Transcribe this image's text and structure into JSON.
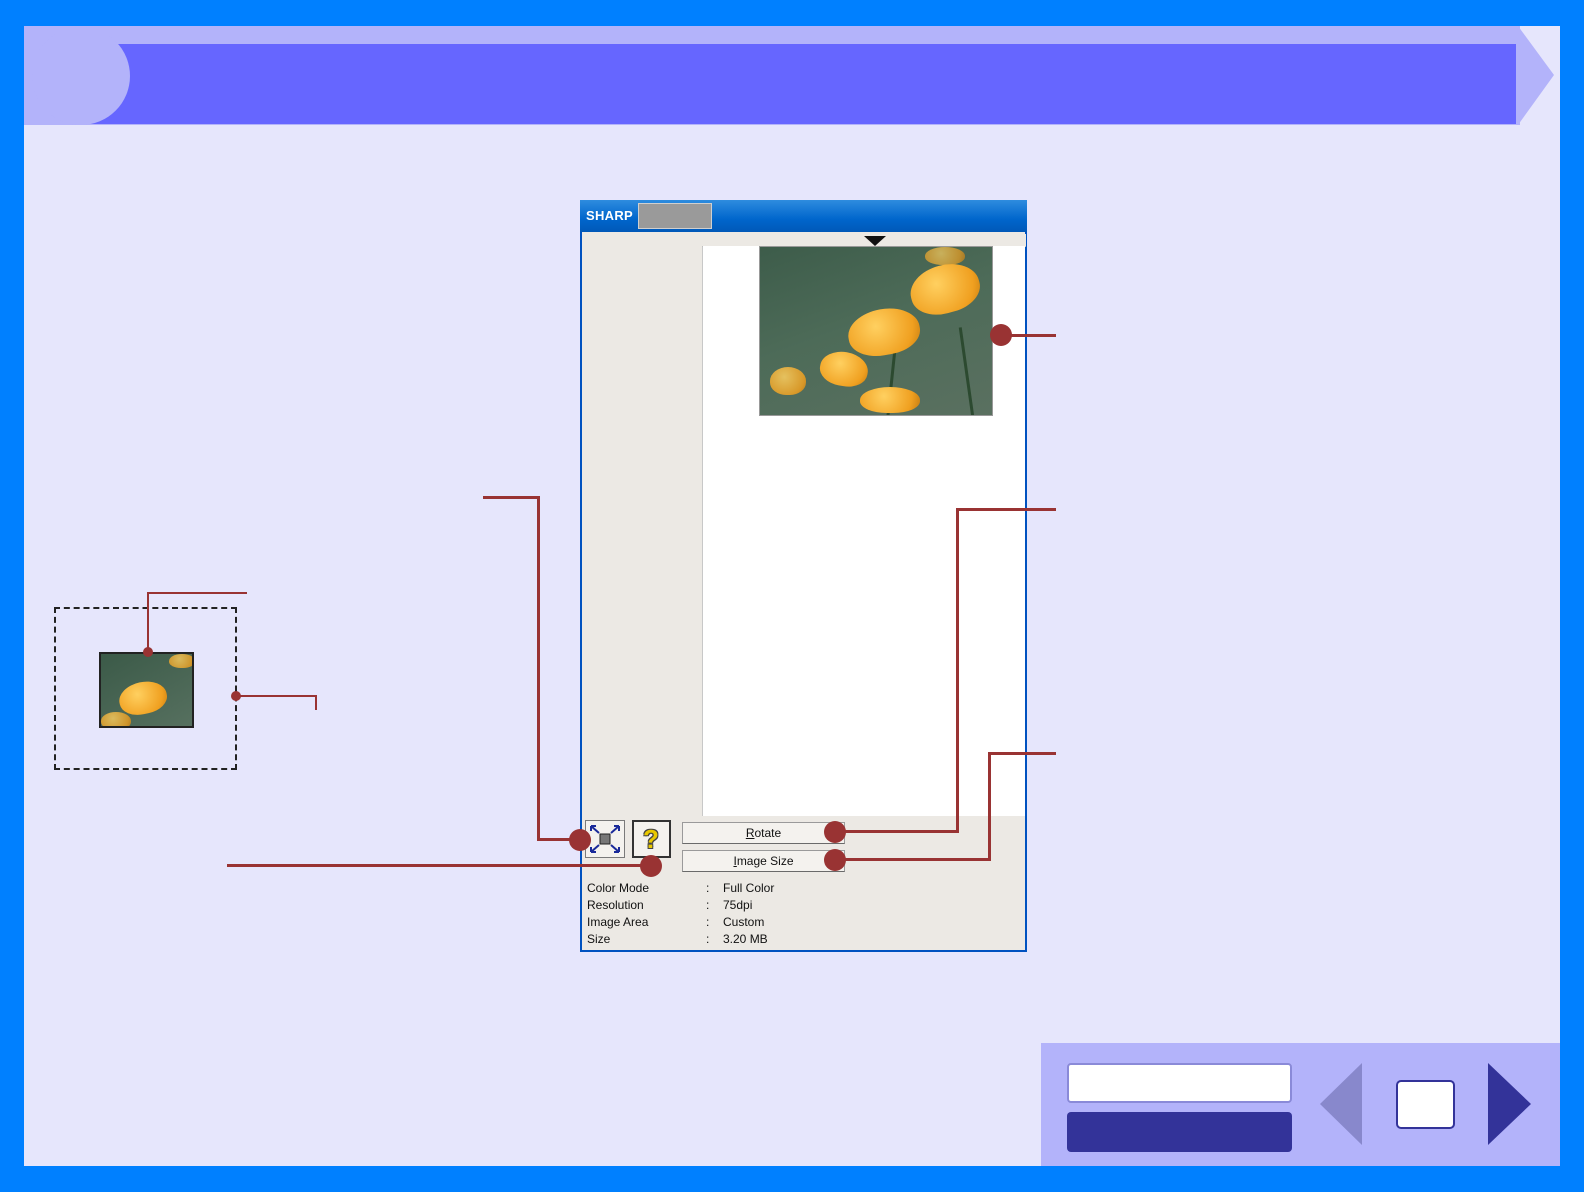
{
  "window": {
    "brand": "SHARP"
  },
  "buttons": {
    "rotate_label": "Rotate",
    "rotate_mnemonic": "R",
    "image_size_label": "Image Size",
    "image_size_mnemonic": "I"
  },
  "info": [
    {
      "label": "Color Mode",
      "sep": ":",
      "value": "Full Color"
    },
    {
      "label": "Resolution",
      "sep": ":",
      "value": "75dpi"
    },
    {
      "label": "Image Area",
      "sep": ":",
      "value": "Custom"
    },
    {
      "label": "Size",
      "sep": ":",
      "value": "3.20 MB"
    }
  ],
  "icons": {
    "zoom": "zoom-fit-icon",
    "help": "help-icon",
    "ruler_marker": "ruler-marker-icon",
    "prev": "prev-arrow-icon",
    "next": "next-arrow-icon"
  },
  "help_glyph": "?",
  "colors": {
    "background": "#0080ff",
    "page": "#e6e6fc",
    "header_light": "#b3b3fa",
    "header_bar": "#6666ff",
    "callout": "#993333",
    "titlebar": "#0066cc",
    "nav_dark": "#333399"
  }
}
